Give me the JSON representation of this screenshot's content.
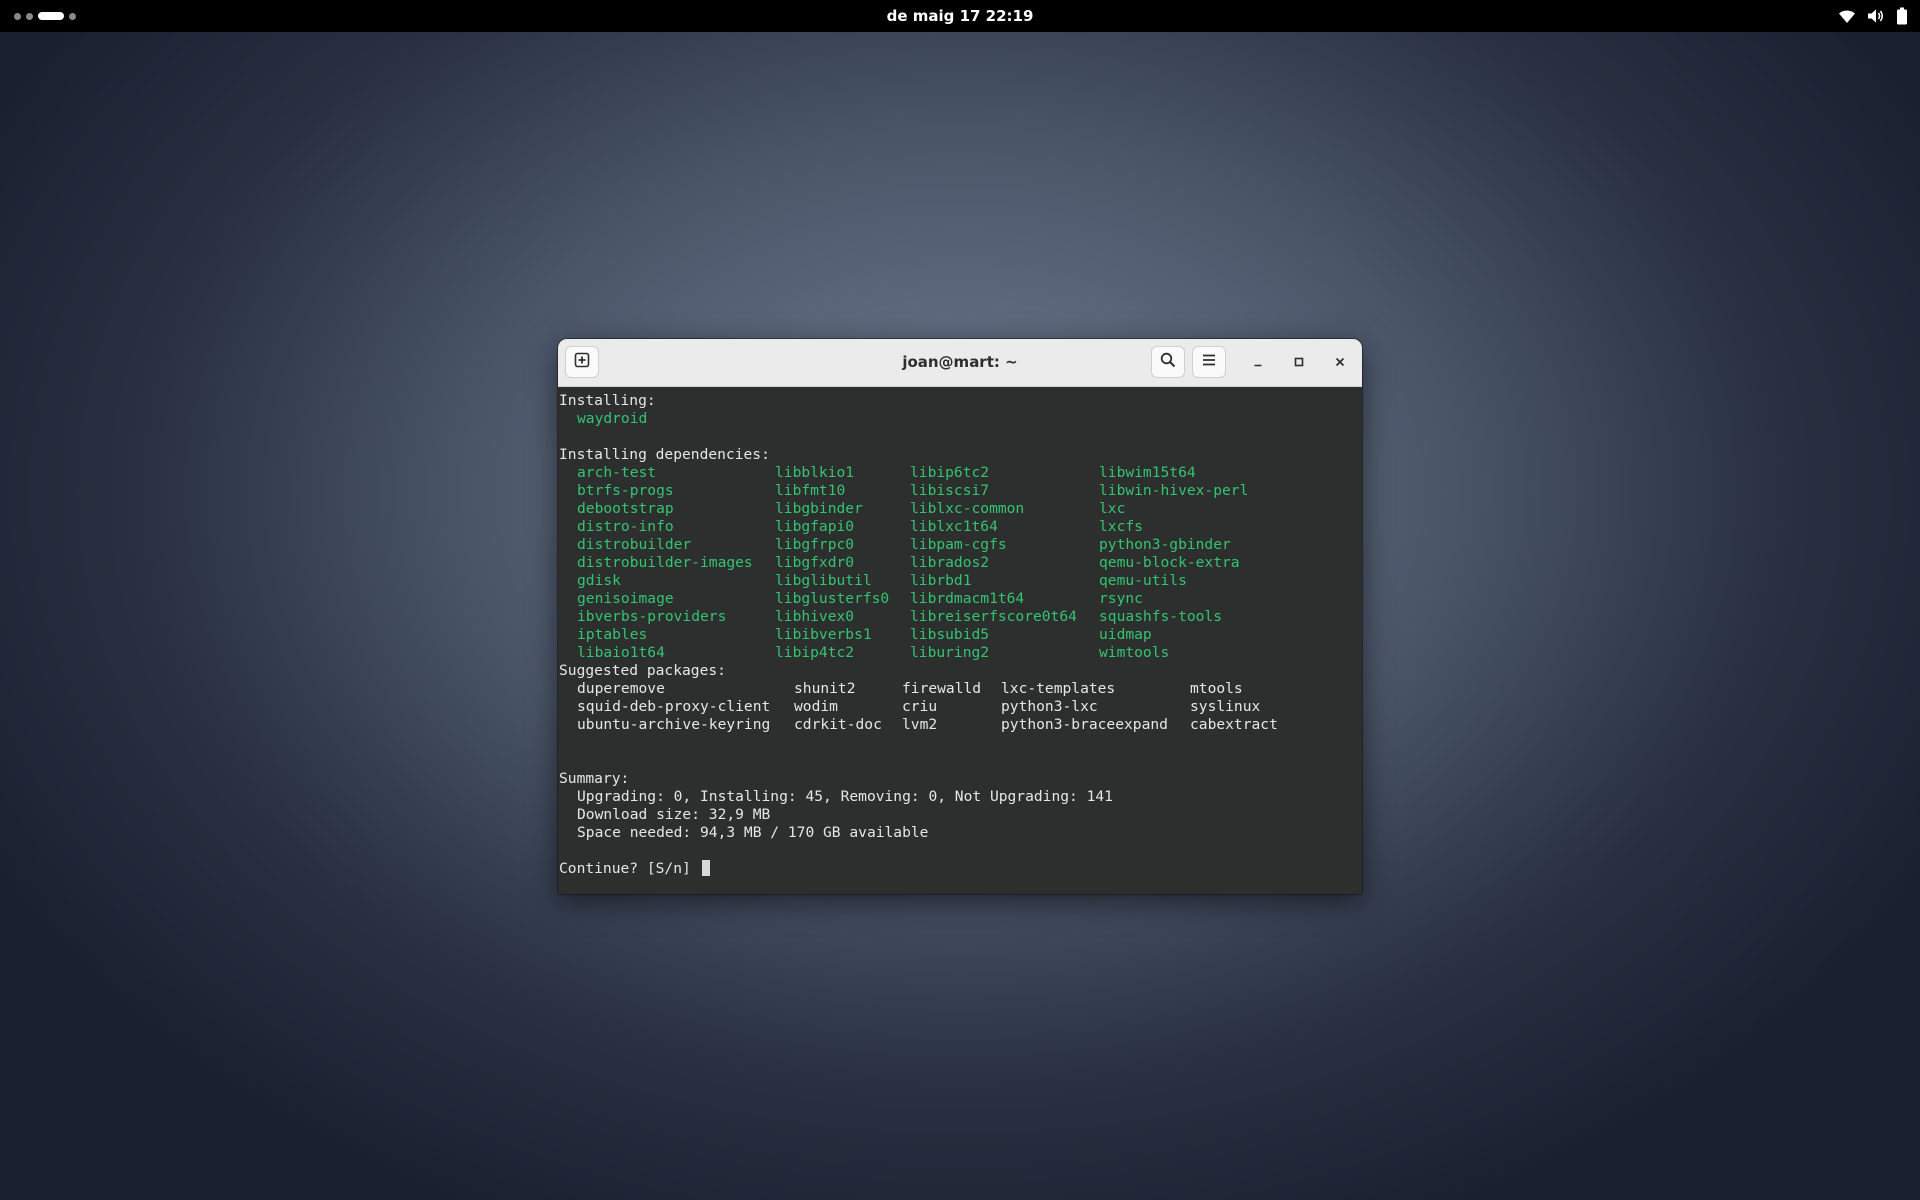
{
  "topbar": {
    "clock": "de maig 17  22:19",
    "workspaces": {
      "count": 4,
      "active_index": 2
    },
    "tray_icons": [
      "wifi-icon",
      "volume-icon",
      "battery-icon"
    ]
  },
  "window": {
    "title": "joan@mart: ~",
    "buttons": [
      "new-tab-icon",
      "search-icon",
      "menu-icon",
      "minimize-icon",
      "maximize-icon",
      "close-icon"
    ]
  },
  "terminal": {
    "installing_header": "Installing:",
    "installing_packages": [
      "waydroid"
    ],
    "dependencies_header": "Installing dependencies:",
    "dependencies": [
      [
        "arch-test",
        "libblkio1",
        "libip6tc2",
        "libwim15t64"
      ],
      [
        "btrfs-progs",
        "libfmt10",
        "libiscsi7",
        "libwin-hivex-perl"
      ],
      [
        "debootstrap",
        "libgbinder",
        "liblxc-common",
        "lxc"
      ],
      [
        "distro-info",
        "libgfapi0",
        "liblxc1t64",
        "lxcfs"
      ],
      [
        "distrobuilder",
        "libgfrpc0",
        "libpam-cgfs",
        "python3-gbinder"
      ],
      [
        "distrobuilder-images",
        "libgfxdr0",
        "librados2",
        "qemu-block-extra"
      ],
      [
        "gdisk",
        "libglibutil",
        "librbd1",
        "qemu-utils"
      ],
      [
        "genisoimage",
        "libglusterfs0",
        "librdmacm1t64",
        "rsync"
      ],
      [
        "ibverbs-providers",
        "libhivex0",
        "libreiserfscore0t64",
        "squashfs-tools"
      ],
      [
        "iptables",
        "libibverbs1",
        "libsubid5",
        "uidmap"
      ],
      [
        "libaio1t64",
        "libip4tc2",
        "liburing2",
        "wimtools"
      ]
    ],
    "suggested_header": "Suggested packages:",
    "suggested": [
      [
        "duperemove",
        "shunit2",
        "firewalld",
        "lxc-templates",
        "mtools"
      ],
      [
        "squid-deb-proxy-client",
        "wodim",
        "criu",
        "python3-lxc",
        "syslinux"
      ],
      [
        "ubuntu-archive-keyring",
        "cdrkit-doc",
        "lvm2",
        "python3-braceexpand",
        "cabextract"
      ]
    ],
    "summary_header": "Summary:",
    "summary_lines": [
      "Upgrading: 0, Installing: 45, Removing: 0, Not Upgrading: 141",
      "Download size: 32,9 MB",
      "Space needed: 94,3 MB / 170 GB available"
    ],
    "prompt": "Continue? [S/n] "
  },
  "colors": {
    "package_green": "#33c470",
    "terminal_bg": "#2d2f2f",
    "terminal_fg": "#e6e6e6",
    "headerbar_bg": "#ebebeb"
  }
}
